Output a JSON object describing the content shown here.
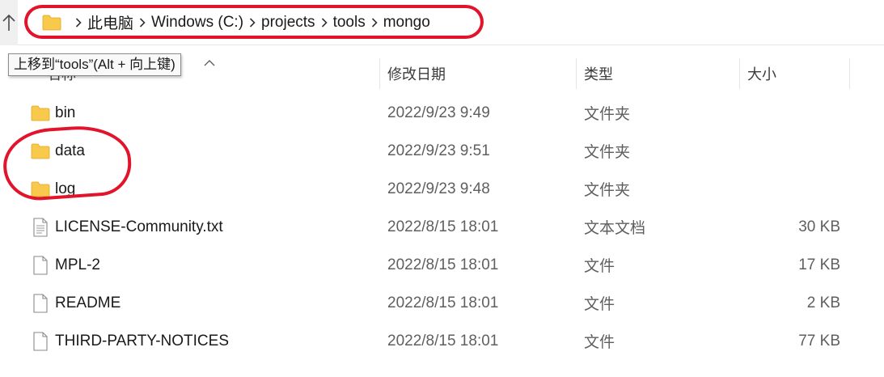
{
  "address_bar": {
    "crumbs": [
      "此电脑",
      "Windows (C:)",
      "projects",
      "tools",
      "mongo"
    ]
  },
  "tooltip": {
    "text": "上移到“tools”(Alt + 向上键)"
  },
  "columns": {
    "name": "名称",
    "date": "修改日期",
    "type": "类型",
    "size": "大小"
  },
  "files": [
    {
      "name": "bin",
      "date": "2022/9/23 9:49",
      "type": "文件夹",
      "size": "",
      "icon": "folder-icon"
    },
    {
      "name": "data",
      "date": "2022/9/23 9:51",
      "type": "文件夹",
      "size": "",
      "icon": "folder-icon"
    },
    {
      "name": "log",
      "date": "2022/9/23 9:48",
      "type": "文件夹",
      "size": "",
      "icon": "folder-icon"
    },
    {
      "name": "LICENSE-Community.txt",
      "date": "2022/8/15 18:01",
      "type": "文本文档",
      "size": "30 KB",
      "icon": "text-document-icon"
    },
    {
      "name": "MPL-2",
      "date": "2022/8/15 18:01",
      "type": "文件",
      "size": "17 KB",
      "icon": "file-icon"
    },
    {
      "name": "README",
      "date": "2022/8/15 18:01",
      "type": "文件",
      "size": "2 KB",
      "icon": "file-icon"
    },
    {
      "name": "THIRD-PARTY-NOTICES",
      "date": "2022/8/15 18:01",
      "type": "文件",
      "size": "77 KB",
      "icon": "file-icon"
    }
  ],
  "colors": {
    "annotation": "#e2142b",
    "folder": "#f8c94a"
  }
}
